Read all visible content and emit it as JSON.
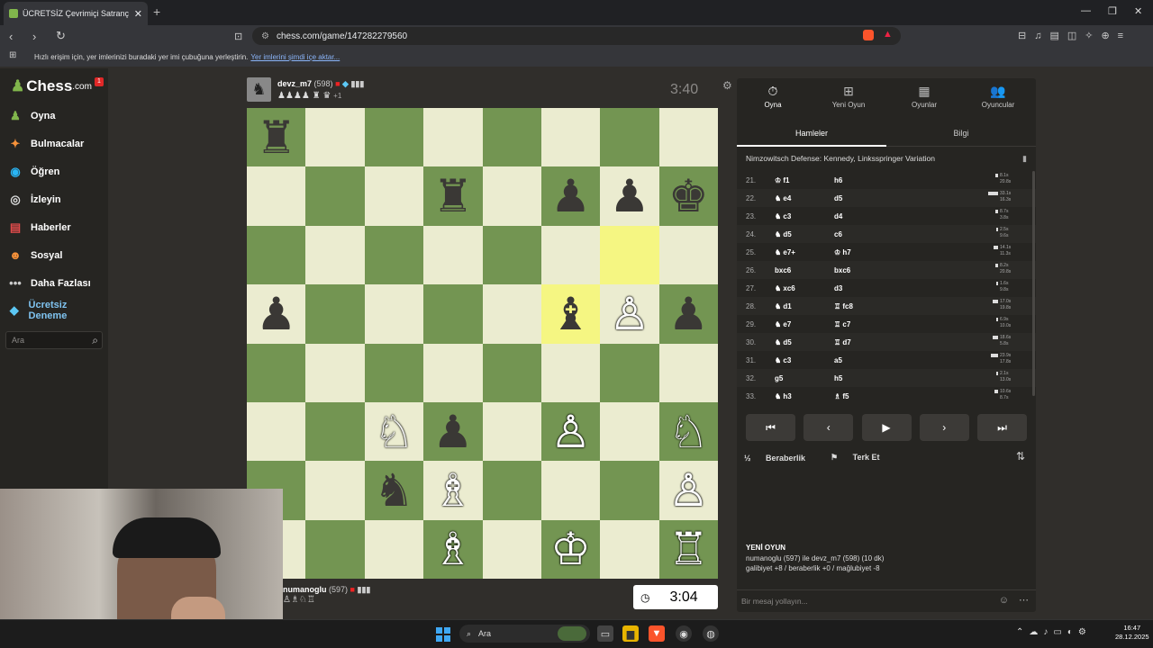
{
  "browser": {
    "tab_title": "ÜCRETSİZ Çevrimiçi Satranç Oyna",
    "url": "chess.com/game/147282279560",
    "bookmark_text": "Hızlı erişim için, yer imlerinizi buradaki yer imi çubuğuna yerleştirin.",
    "bookmark_link": "Yer imlerini şimdi içe aktar..."
  },
  "sidebar": {
    "logo": "Chess",
    "logo_suffix": ".com",
    "notification": "1",
    "items": [
      {
        "label": "Oyna",
        "icon": "play-board-icon"
      },
      {
        "label": "Bulmacalar",
        "icon": "puzzle-icon"
      },
      {
        "label": "Öğren",
        "icon": "learn-icon"
      },
      {
        "label": "İzleyin",
        "icon": "watch-icon"
      },
      {
        "label": "Haberler",
        "icon": "news-icon"
      },
      {
        "label": "Sosyal",
        "icon": "social-icon"
      },
      {
        "label": "Daha Fazlası",
        "icon": "more-icon"
      },
      {
        "label": "Ücretsiz Deneme",
        "icon": "diamond-icon"
      }
    ],
    "search_placeholder": "Ara"
  },
  "opponent": {
    "name": "devz_m7",
    "rating": "(598)",
    "captured": "♟♟♟♟ ♜ ♛",
    "advantage": "+1",
    "clock": "3:40"
  },
  "player": {
    "name": "numanoglu",
    "rating": "(597)",
    "captured": "♙♗♘♖",
    "clock": "3:04"
  },
  "board": {
    "light_color": "#ebecd0",
    "dark_color": "#739552",
    "highlight": [
      "f5",
      "g6"
    ],
    "pieces": [
      {
        "sq": "a8",
        "p": "♜",
        "c": "b"
      },
      {
        "sq": "d7",
        "p": "♜",
        "c": "b"
      },
      {
        "sq": "f7",
        "p": "♟",
        "c": "b"
      },
      {
        "sq": "g7",
        "p": "♟",
        "c": "b"
      },
      {
        "sq": "h7",
        "p": "♚",
        "c": "b"
      },
      {
        "sq": "a5",
        "p": "♟",
        "c": "b"
      },
      {
        "sq": "f5",
        "p": "♝",
        "c": "b"
      },
      {
        "sq": "g5",
        "p": "♙",
        "c": "w"
      },
      {
        "sq": "h5",
        "p": "♟",
        "c": "b"
      },
      {
        "sq": "c3",
        "p": "♘",
        "c": "w"
      },
      {
        "sq": "d3",
        "p": "♟",
        "c": "b"
      },
      {
        "sq": "f3",
        "p": "♙",
        "c": "w"
      },
      {
        "sq": "h3",
        "p": "♘",
        "c": "w"
      },
      {
        "sq": "c2",
        "p": "♞",
        "c": "b"
      },
      {
        "sq": "d2",
        "p": "♗",
        "c": "w"
      },
      {
        "sq": "h2",
        "p": "♙",
        "c": "w"
      },
      {
        "sq": "d1",
        "p": "♗",
        "c": "w"
      },
      {
        "sq": "f1",
        "p": "♔",
        "c": "w"
      },
      {
        "sq": "h1",
        "p": "♖",
        "c": "w"
      }
    ]
  },
  "panel": {
    "tabs": [
      {
        "label": "Oyna",
        "icon": "⏱"
      },
      {
        "label": "Yeni Oyun",
        "icon": "⊞"
      },
      {
        "label": "Oyunlar",
        "icon": "▦"
      },
      {
        "label": "Oyuncular",
        "icon": "👥"
      }
    ],
    "subtabs": [
      "Hamleler",
      "Bilgi"
    ],
    "opening": "Nimzowitsch Defense: Kennedy, Linksspringer Variation",
    "moves": [
      {
        "n": "21.",
        "w": "♔ f1",
        "b": "h6",
        "t1": "8.1s",
        "t2": "20.8s"
      },
      {
        "n": "22.",
        "w": "♞ e4",
        "b": "d5",
        "t1": "33.1s",
        "t2": "16.3s"
      },
      {
        "n": "23.",
        "w": "♞ c3",
        "b": "d4",
        "t1": "8.7s",
        "t2": "3.8s"
      },
      {
        "n": "24.",
        "w": "♞ d5",
        "b": "c6",
        "t1": "2.5s",
        "t2": "9.6s"
      },
      {
        "n": "25.",
        "w": "♞ e7+",
        "b": "♔ h7",
        "t1": "14.1s",
        "t2": "11.3s"
      },
      {
        "n": "26.",
        "w": "bxc6",
        "b": "bxc6",
        "t1": "8.2s",
        "t2": "20.8s"
      },
      {
        "n": "27.",
        "w": "♞ xc6",
        "b": "d3",
        "t1": "1.6s",
        "t2": "9.8s"
      },
      {
        "n": "28.",
        "w": "♞ d1",
        "b": "♖ fc8",
        "t1": "17.0s",
        "t2": "19.8s"
      },
      {
        "n": "29.",
        "w": "♞ e7",
        "b": "♖ c7",
        "t1": "6.9s",
        "t2": "10.0s"
      },
      {
        "n": "30.",
        "w": "♞ d5",
        "b": "♖ d7",
        "t1": "18.6s",
        "t2": "5.8s"
      },
      {
        "n": "31.",
        "w": "♞ c3",
        "b": "a5",
        "t1": "23.9s",
        "t2": "17.8s"
      },
      {
        "n": "32.",
        "w": "g5",
        "b": "h5",
        "t1": "2.1s",
        "t2": "13.0s"
      },
      {
        "n": "33.",
        "w": "♞ h3",
        "b": "♗ f5",
        "t1": "10.6s",
        "t2": "8.7s"
      }
    ],
    "draw": "Beraberlik",
    "resign": "Terk Et",
    "new_game_title": "YENİ OYUN",
    "new_game_line1": "numanoglu (597) ile devz_m7 (598) (10 dk)",
    "new_game_line2": "galibiyet +8 / beraberlik +0 / mağlubiyet -8",
    "chat_placeholder": "Bir mesaj yollayın..."
  },
  "taskbar": {
    "search": "Ara",
    "time": "16:47",
    "date": "28.12.2025"
  }
}
